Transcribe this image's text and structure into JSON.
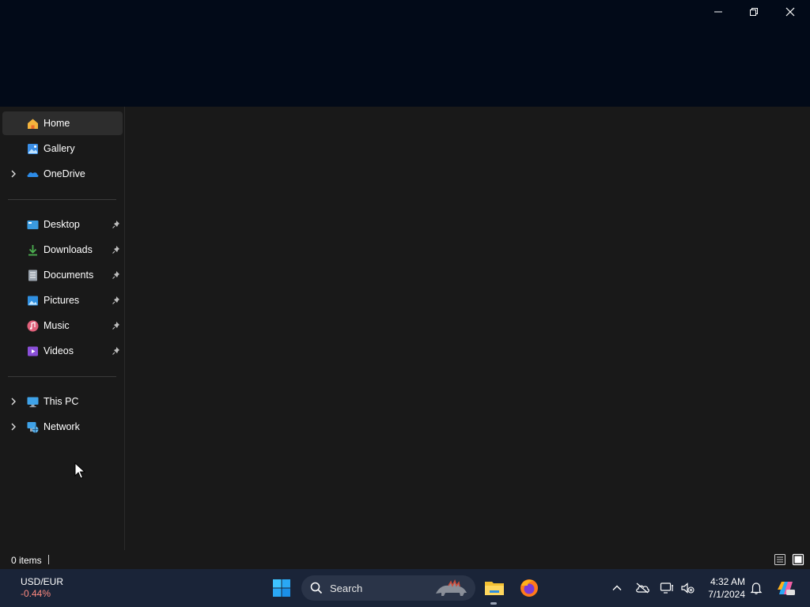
{
  "window": {
    "caption_buttons": {
      "minimize_icon": "minimize-icon",
      "restore_icon": "restore-icon",
      "close_icon": "close-icon"
    }
  },
  "sidebar": {
    "top_items": [
      {
        "label": "Home",
        "icon": "home-icon",
        "selected": true,
        "expandable": false
      },
      {
        "label": "Gallery",
        "icon": "gallery-icon",
        "selected": false,
        "expandable": false
      },
      {
        "label": "OneDrive",
        "icon": "onedrive-icon",
        "selected": false,
        "expandable": true
      }
    ],
    "pinned_items": [
      {
        "label": "Desktop",
        "icon": "desktop-folder-icon",
        "pinned": true
      },
      {
        "label": "Downloads",
        "icon": "downloads-icon",
        "pinned": true
      },
      {
        "label": "Documents",
        "icon": "documents-icon",
        "pinned": true
      },
      {
        "label": "Pictures",
        "icon": "pictures-icon",
        "pinned": true
      },
      {
        "label": "Music",
        "icon": "music-icon",
        "pinned": true
      },
      {
        "label": "Videos",
        "icon": "videos-icon",
        "pinned": true
      }
    ],
    "bottom_items": [
      {
        "label": "This PC",
        "icon": "this-pc-icon",
        "expandable": true
      },
      {
        "label": "Network",
        "icon": "network-icon",
        "expandable": true
      }
    ]
  },
  "statusbar": {
    "item_count": "0 items"
  },
  "taskbar": {
    "widget": {
      "pair": "USD/EUR",
      "change": "-0.44%"
    },
    "search": {
      "label": "Search"
    },
    "clock": {
      "time": "4:32 AM",
      "date": "7/1/2024"
    }
  },
  "colors": {
    "titlebar": "#020a18",
    "window_bg": "#191919",
    "taskbar": "#1a2438",
    "selected_item": "#2d2d2d",
    "change_negative": "#ff8a80"
  }
}
